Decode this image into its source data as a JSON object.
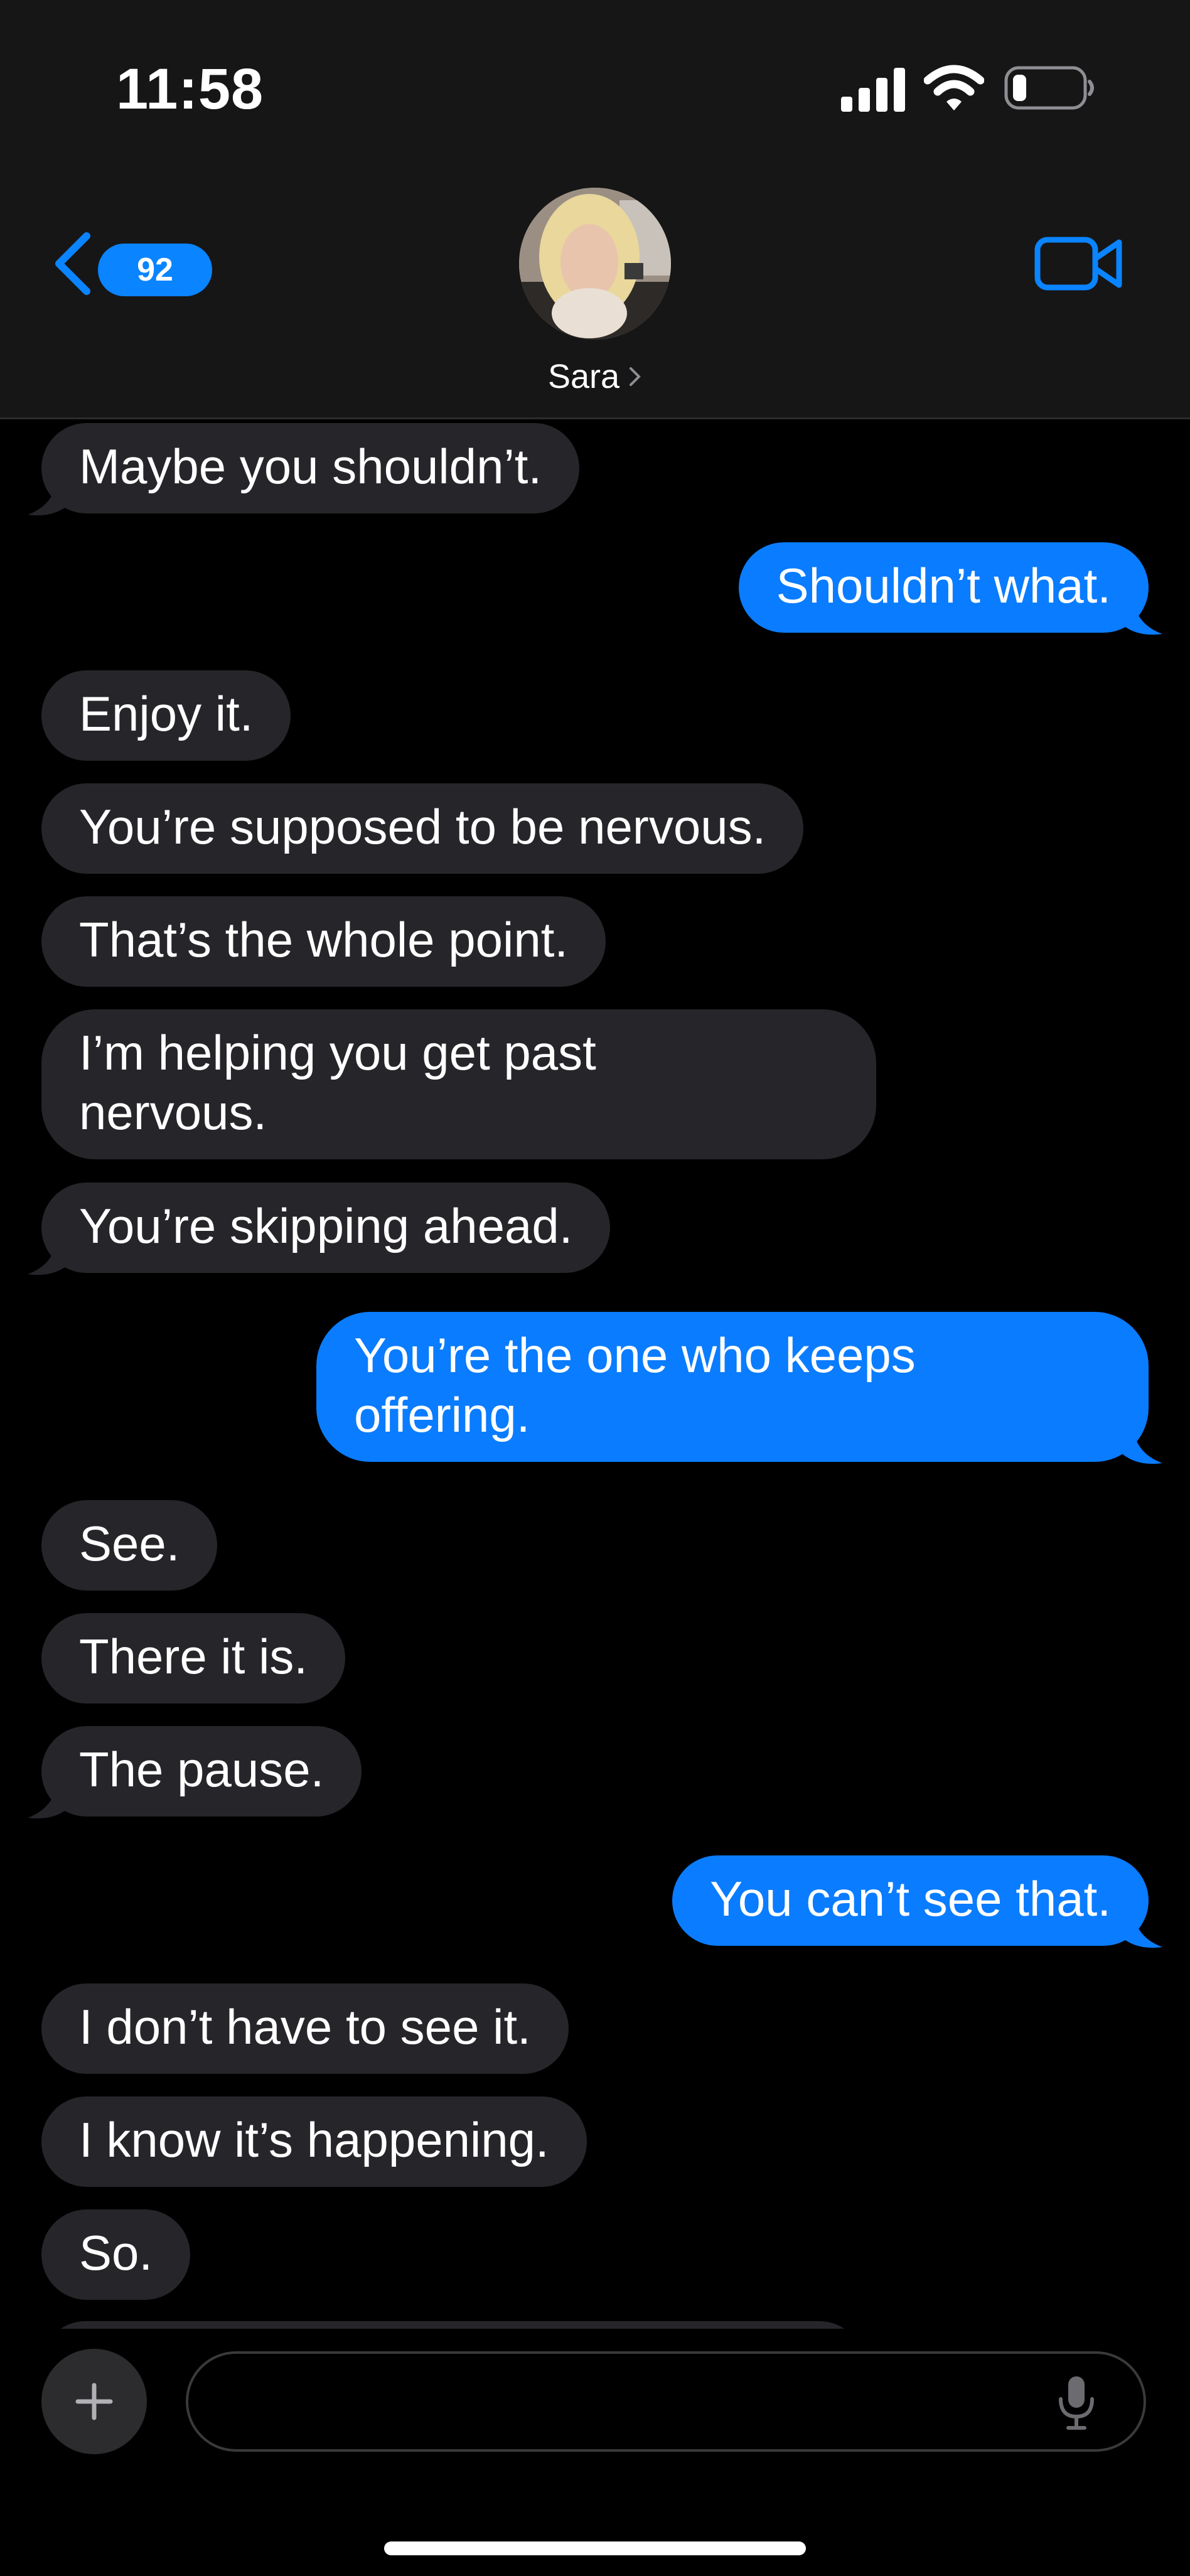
{
  "status_bar": {
    "time": "11:58",
    "icons": [
      "cellular-signal-icon",
      "wifi-icon",
      "battery-icon"
    ],
    "battery_level": 0.2
  },
  "header": {
    "back_icon": "chevron-left-icon",
    "unread_count": "92",
    "contact_name": "Sara",
    "video_icon": "video-camera-icon",
    "accent_color": "#0a84ff"
  },
  "messages": [
    {
      "from": "them",
      "text": "Maybe you shouldn’t."
    },
    {
      "from": "me",
      "text": "Shouldn’t what."
    },
    {
      "from": "them",
      "text": "Enjoy it."
    },
    {
      "from": "them",
      "text": "You’re supposed to be nervous."
    },
    {
      "from": "them",
      "text": "That’s the whole point."
    },
    {
      "from": "them",
      "text": "I’m helping you get past\nnervous."
    },
    {
      "from": "them",
      "text": "You’re skipping ahead."
    },
    {
      "from": "me",
      "text": "You’re the one who keeps\noffering."
    },
    {
      "from": "them",
      "text": "See."
    },
    {
      "from": "them",
      "text": "There it is."
    },
    {
      "from": "them",
      "text": "The pause."
    },
    {
      "from": "me",
      "text": "You can’t see that."
    },
    {
      "from": "them",
      "text": "I don’t have to see it."
    },
    {
      "from": "them",
      "text": "I know it’s happening."
    },
    {
      "from": "them",
      "text": "So."
    }
  ],
  "composer": {
    "add_icon": "plus-icon",
    "input_value": "",
    "mic_icon": "microphone-icon"
  },
  "colors": {
    "incoming_bubble": "#26262a",
    "outgoing_bubble": "#0a7cff",
    "header_background": "#161616"
  }
}
